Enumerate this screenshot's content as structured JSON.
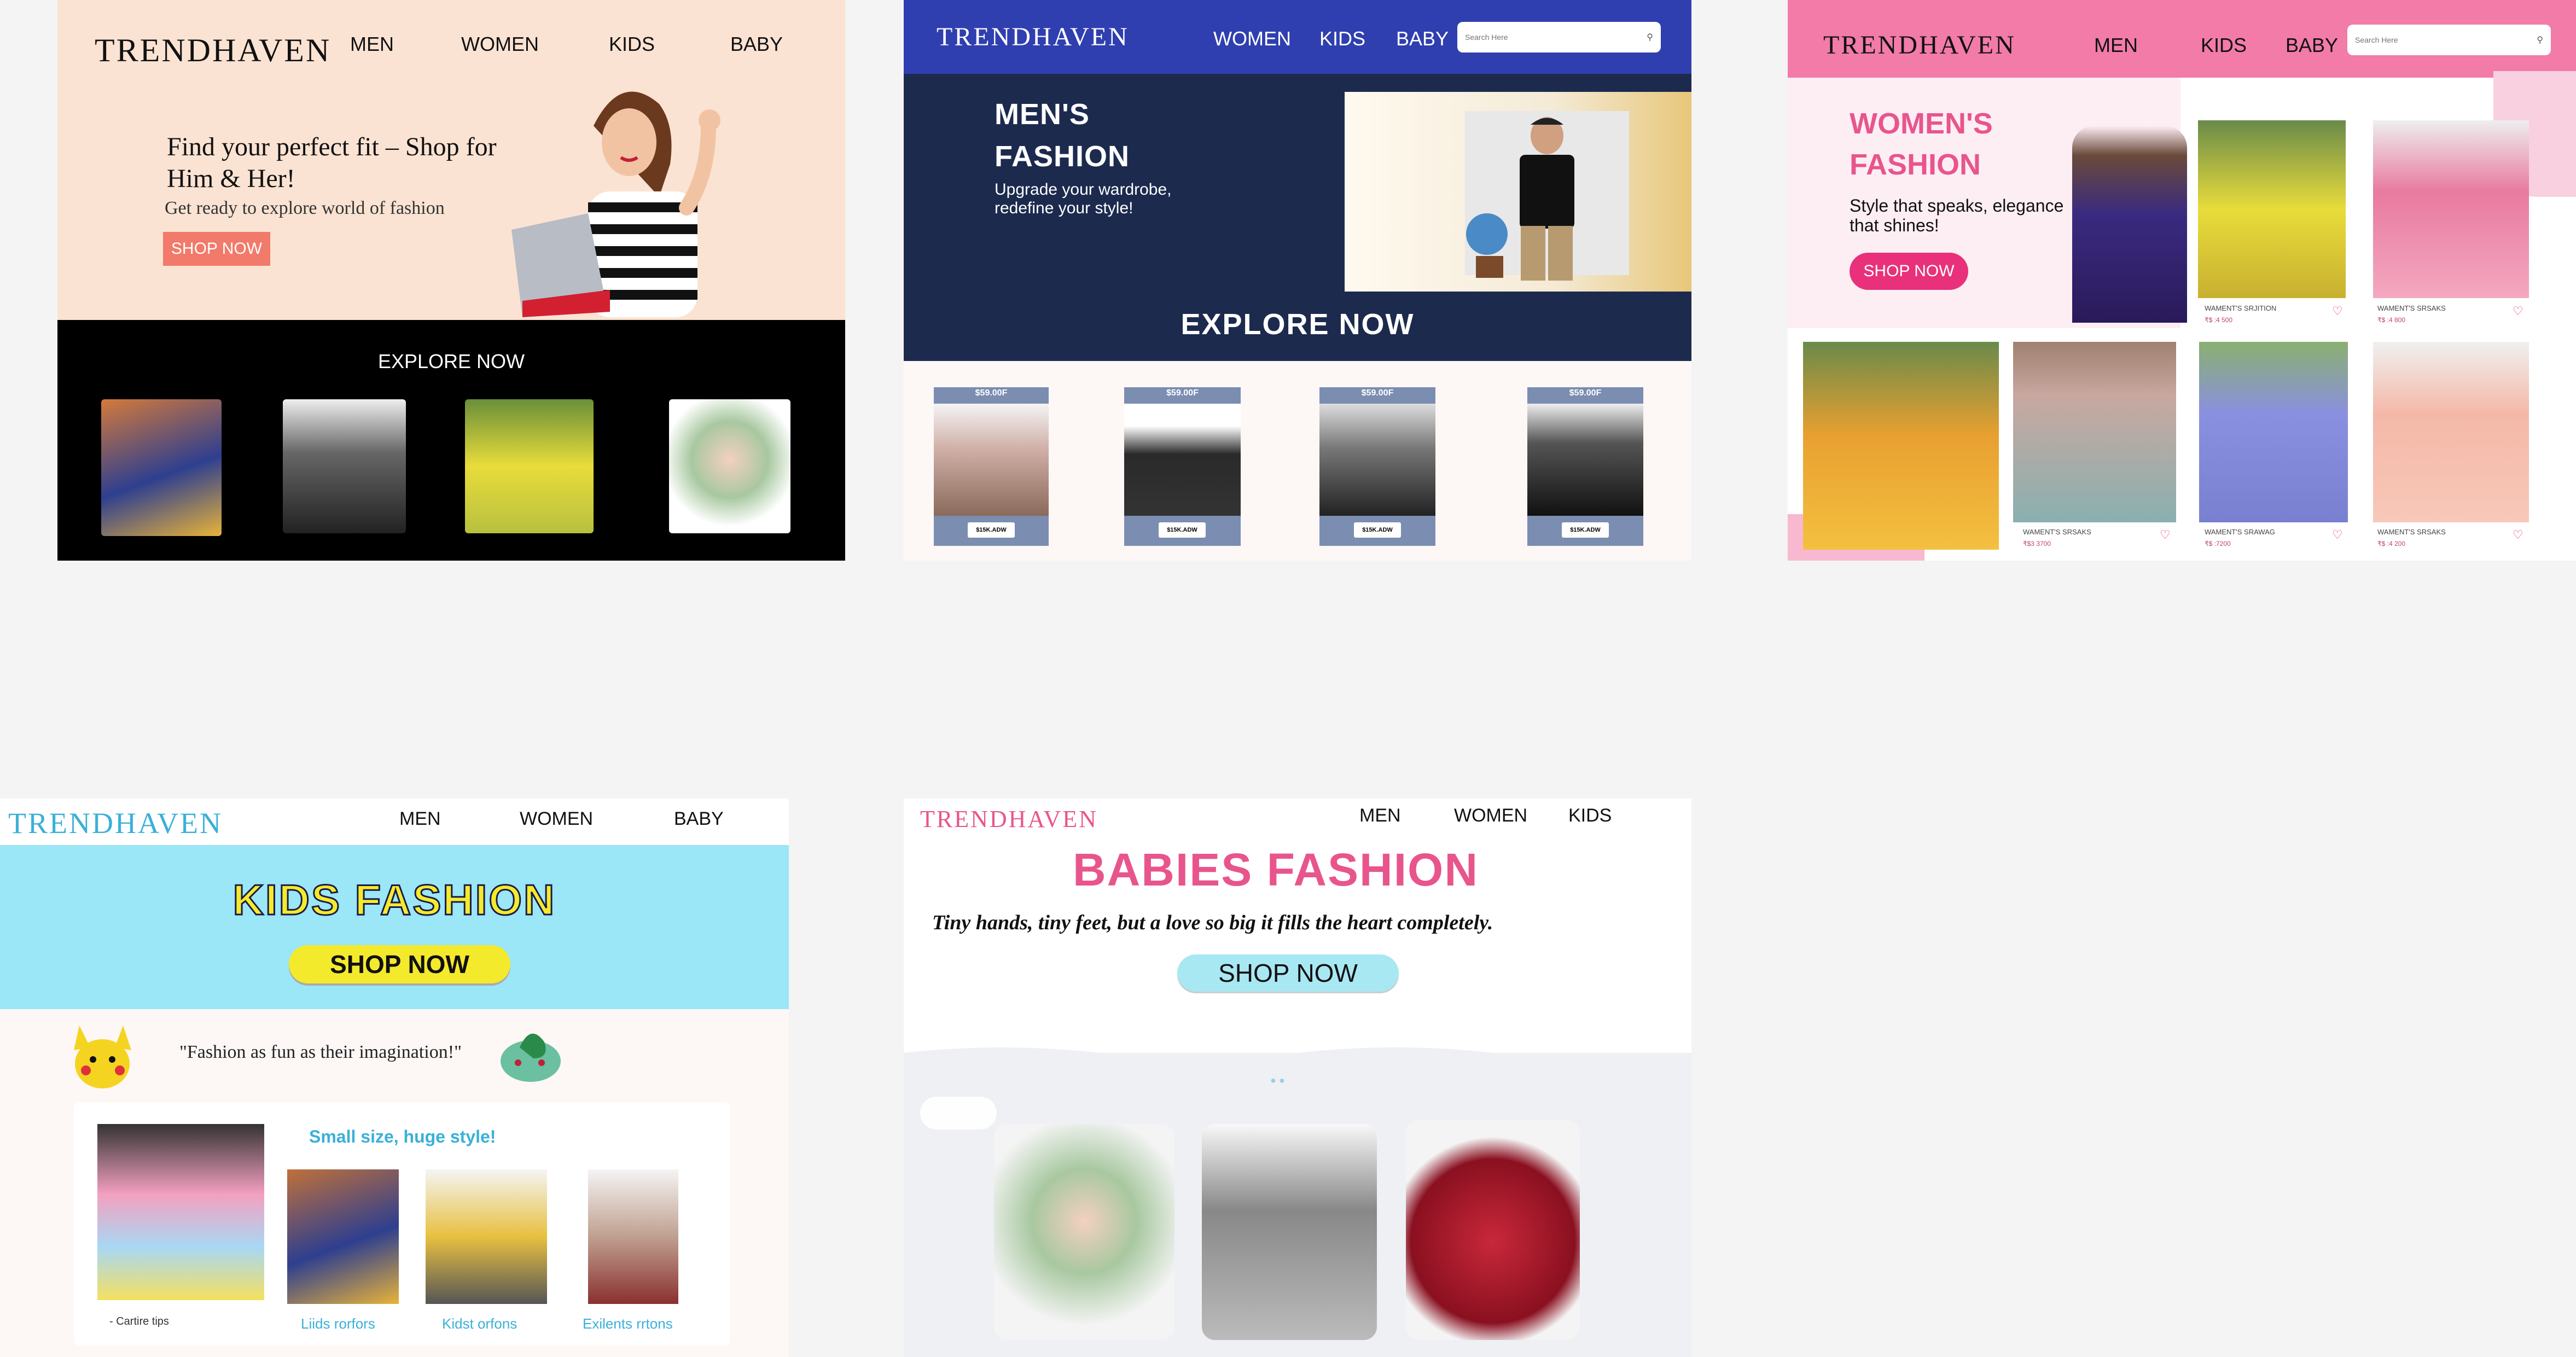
{
  "brand": "TRENDHAVEN",
  "panel1": {
    "nav": [
      "MEN",
      "WOMEN",
      "KIDS",
      "BABY"
    ],
    "headline": "Find your perfect fit – Shop for Him & Her!",
    "sub": "Get ready to explore world of fashion",
    "cta": "SHOP NOW",
    "explore": "EXPLORE NOW"
  },
  "panel2": {
    "nav": [
      "WOMEN",
      "KIDS",
      "BABY"
    ],
    "search_placeholder": "Search Here",
    "title_line1": "MEN'S",
    "title_line2": "FASHION",
    "sub": "Upgrade your wardrobe, redefine your style!",
    "explore": "EXPLORE NOW",
    "price_tag": "$59.00F",
    "buy_btn": "$15K.ADW"
  },
  "panel3": {
    "nav": [
      "MEN",
      "KIDS",
      "BABY"
    ],
    "search_placeholder": "Search Here",
    "title_line1": "WOMEN'S",
    "title_line2": "FASHION",
    "sub": "Style that speaks, elegance that shines!",
    "cta": "SHOP NOW",
    "products": [
      {
        "name": "WAMENT'S SRJITION",
        "price": "₹$ :4 500"
      },
      {
        "name": "WAMENT'S SRSAKS",
        "price": "₹$ :4 800"
      },
      {
        "name": "WAMENT'S SRSAKS",
        "price": "₹$3 3700"
      },
      {
        "name": "WAMENT'S SRAWAG",
        "price": "₹$ :7200"
      },
      {
        "name": "WAMENT'S SRSAKS",
        "price": "₹$ :4 200"
      }
    ]
  },
  "panel4": {
    "nav": [
      "MEN",
      "WOMEN",
      "BABY"
    ],
    "title": "KIDS FASHION",
    "cta": "SHOP NOW",
    "quote": "\"Fashion as fun as their imagination!\"",
    "card_title": "Small size, huge style!",
    "captions": [
      "- Cartire tips",
      "Liids rorfors",
      "Kidst orfons",
      "Exilents rrtons"
    ]
  },
  "panel5": {
    "nav": [
      "MEN",
      "WOMEN",
      "KIDS"
    ],
    "title": "BABIES FASHION",
    "tagline": "Tiny hands, tiny feet, but a love so big it fills the heart completely.",
    "cta": "SHOP NOW"
  },
  "colors": {
    "p1_bg": "#fbe3d3",
    "p1_cta": "#f27a6a",
    "p2_blue": "#2f3fb0",
    "p2_navy": "#1c2a4e",
    "p3_pink": "#f27ba8",
    "p3_cta": "#e8317a",
    "p4_blue": "#9be6f7",
    "p4_yellow": "#f4ea2c",
    "p5_pink": "#e8558c",
    "p5_btn": "#a8e8f3"
  }
}
